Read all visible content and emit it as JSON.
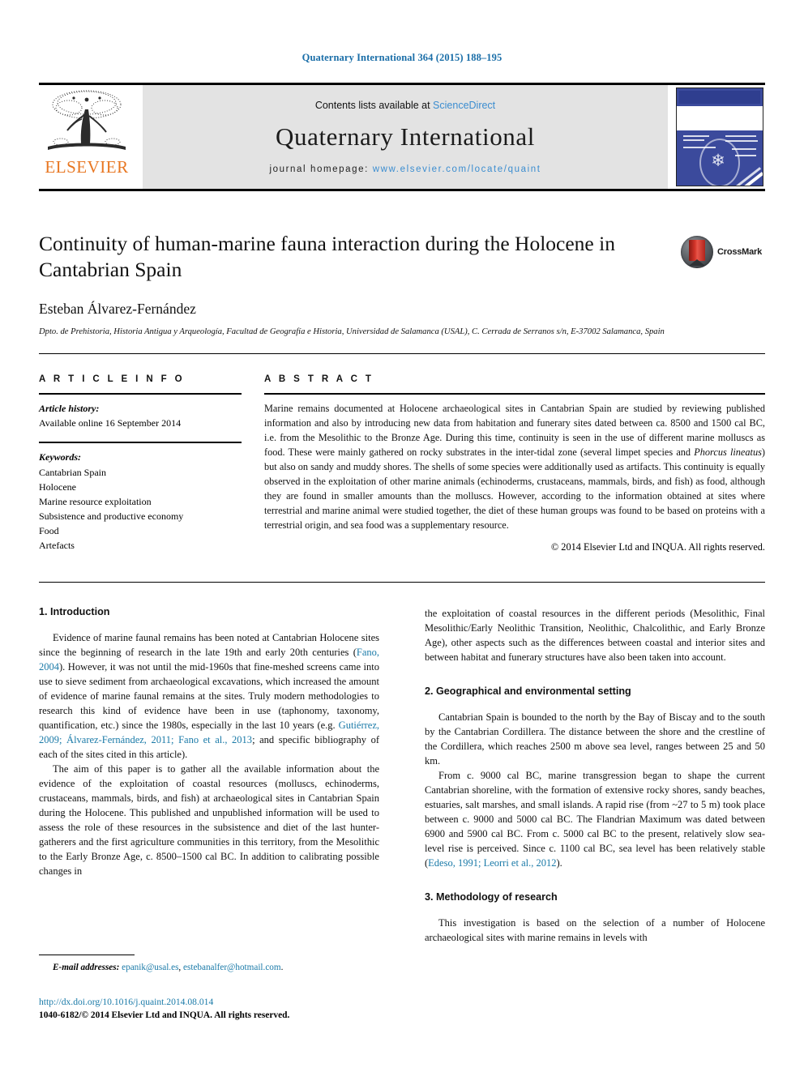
{
  "running_head": "Quaternary International 364 (2015) 188–195",
  "masthead": {
    "publisher": "ELSEVIER",
    "contents_prefix": "Contents lists available at ",
    "contents_link": "ScienceDirect",
    "journal_title": "Quaternary International",
    "homepage_prefix": "journal homepage: ",
    "homepage_url": "www.elsevier.com/locate/quaint",
    "cover_alt": "journal-cover-thumbnail"
  },
  "article": {
    "title": "Continuity of human-marine fauna interaction during the Holocene in Cantabrian Spain",
    "author": "Esteban Álvarez-Fernández",
    "affiliation": "Dpto. de Prehistoria, Historia Antigua y Arqueología, Facultad de Geografía e Historia, Universidad de Salamanca (USAL), C. Cerrada de Serranos s/n, E-37002 Salamanca, Spain",
    "crossmark_label": "CrossMark"
  },
  "info": {
    "heading": "A R T I C L E   I N F O",
    "history_label": "Article history:",
    "history_value": "Available online 16 September 2014",
    "keywords_label": "Keywords:",
    "keywords": [
      "Cantabrian Spain",
      "Holocene",
      "Marine resource exploitation",
      "Subsistence and productive economy",
      "Food",
      "Artefacts"
    ]
  },
  "abstract": {
    "heading": "A B S T R A C T",
    "para_1": "Marine remains documented at Holocene archaeological sites in Cantabrian Spain are studied by reviewing published information and also by introducing new data from habitation and funerary sites dated between ca. 8500 and 1500 cal BC, i.e. from the Mesolithic to the Bronze Age. During this time, continuity is seen in the use of different marine molluscs as food. These were mainly gathered on rocky substrates in the inter-tidal zone (several limpet species and ",
    "italic_species": "Phorcus lineatus",
    "para_2": ") but also on sandy and muddy shores. The shells of some species were additionally used as artifacts. This continuity is equally observed in the exploitation of other marine animals (echinoderms, crustaceans, mammals, birds, and fish) as food, although they are found in smaller amounts than the molluscs. However, according to the information obtained at sites where terrestrial and marine animal were studied together, the diet of these human groups was found to be based on proteins with a terrestrial origin, and sea food was a supplementary resource.",
    "copyright": "© 2014 Elsevier Ltd and INQUA. All rights reserved."
  },
  "sections": {
    "s1_heading": "1. Introduction",
    "s1_p1_a": "Evidence of marine faunal remains has been noted at Cantabrian Holocene sites since the beginning of research in the late 19th and early 20th centuries (",
    "s1_p1_ref1": "Fano, 2004",
    "s1_p1_b": "). However, it was not until the mid-1960s that fine-meshed screens came into use to sieve sediment from archaeological excavations, which increased the amount of evidence of marine faunal remains at the sites. Truly modern methodologies to research this kind of evidence have been in use (taphonomy, taxonomy, quantification, etc.) since the 1980s, especially in the last 10 years (e.g. ",
    "s1_p1_ref2": "Gutiérrez, 2009; Álvarez-Fernández, 2011; Fano et al., 2013",
    "s1_p1_c": "; and specific bibliography of each of the sites cited in this article).",
    "s1_p2": "The aim of this paper is to gather all the available information about the evidence of the exploitation of coastal resources (molluscs, echinoderms, crustaceans, mammals, birds, and fish) at archaeological sites in Cantabrian Spain during the Holocene. This published and unpublished information will be used to assess the role of these resources in the subsistence and diet of the last hunter-gatherers and the first agriculture communities in this territory, from the Mesolithic to the Early Bronze Age, c. 8500–1500 cal BC. In addition to calibrating possible changes in",
    "s1_p2_cont": "the exploitation of coastal resources in the different periods (Mesolithic, Final Mesolithic/Early Neolithic Transition, Neolithic, Chalcolithic, and Early Bronze Age), other aspects such as the differences between coastal and interior sites and between habitat and funerary structures have also been taken into account.",
    "s2_heading": "2. Geographical and environmental setting",
    "s2_p1": "Cantabrian Spain is bounded to the north by the Bay of Biscay and to the south by the Cantabrian Cordillera. The distance between the shore and the crestline of the Cordillera, which reaches 2500 m above sea level, ranges between 25 and 50 km.",
    "s2_p2_a": "From c. 9000 cal BC, marine transgression began to shape the current Cantabrian shoreline, with the formation of extensive rocky shores, sandy beaches, estuaries, salt marshes, and small islands. A rapid rise (from ~27 to 5 m) took place between c. 9000 and 5000 cal BC. The Flandrian Maximum was dated between 6900 and 5900 cal BC. From c. 5000 cal BC to the present, relatively slow sea-level rise is perceived. Since c. 1100 cal BC, sea level has been relatively stable (",
    "s2_p2_ref": "Edeso, 1991; Leorri et al., 2012",
    "s2_p2_b": ").",
    "s3_heading": "3. Methodology of research",
    "s3_p1": "This investigation is based on the selection of a number of Holocene archaeological sites with marine remains in levels with"
  },
  "footer": {
    "email_label": "E-mail addresses:",
    "email_1": "epanik@usal.es",
    "email_sep": ", ",
    "email_2": "estebanalfer@hotmail.com",
    "email_end": ".",
    "doi": "http://dx.doi.org/10.1016/j.quaint.2014.08.014",
    "issn_line": "1040-6182/© 2014 Elsevier Ltd and INQUA. All rights reserved."
  },
  "colors": {
    "link": "#1a7aa8",
    "running_head": "#1a6ea8",
    "elsevier_orange": "#e87722",
    "sciencedirect": "#3b8dd0",
    "cover_blue": "#3b4a9c"
  }
}
